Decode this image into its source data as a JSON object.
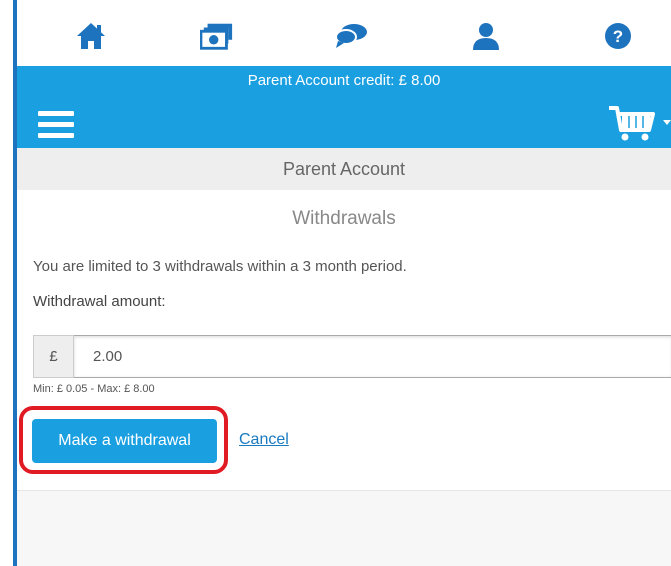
{
  "nav": {
    "icons": [
      "home-icon",
      "cash-icon",
      "chat-icon",
      "user-icon",
      "help-icon"
    ],
    "icon_color": "#1e73be"
  },
  "header": {
    "credit_text": "Parent Account credit: £ 8.00",
    "bar_color": "#1a9fe0"
  },
  "title_bar": {
    "title": "Parent Account"
  },
  "withdrawals": {
    "heading": "Withdrawals",
    "notice": "You are limited to 3 withdrawals within a 3 month period.",
    "amount_label": "Withdrawal amount:",
    "currency_symbol": "£",
    "amount_value": "2.00",
    "hint": "Min: £ 0.05 - Max: £ 8.00",
    "submit_label": "Make a withdrawal",
    "cancel_label": "Cancel",
    "highlight_color": "#e01b24"
  }
}
